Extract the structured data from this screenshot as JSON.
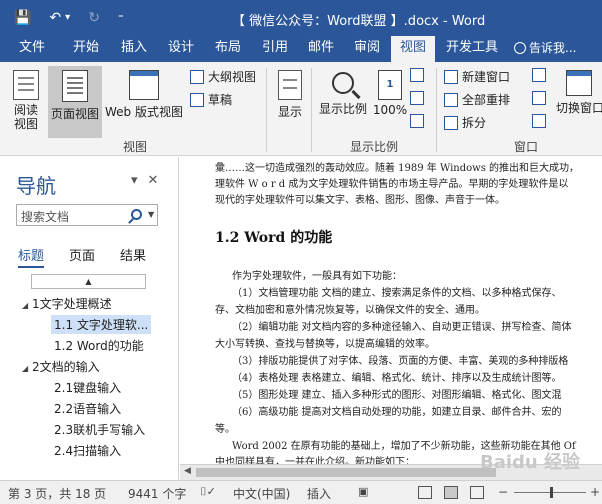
{
  "window": {
    "title": "【 微信公众号：Word联盟 】.docx - Word"
  },
  "qat": {
    "save_icon": "💾",
    "undo_icon": "↶",
    "undo_dropdown": "▾",
    "redo_icon": "↻",
    "customize_icon": "⁼"
  },
  "tabs": [
    "文件",
    "开始",
    "插入",
    "设计",
    "布局",
    "引用",
    "邮件",
    "审阅",
    "视图",
    "开发工具"
  ],
  "active_tab": "视图",
  "tell_me": "告诉我...",
  "ribbon": {
    "views": {
      "read_mode": "阅读视图",
      "print_layout": "页面视图",
      "web_layout": "Web 版式视图",
      "outline": "大纲视图",
      "draft": "草稿",
      "group_label": "视图"
    },
    "show": {
      "label": "显示"
    },
    "zoom": {
      "zoom": "显示比例",
      "hundred": "100%",
      "group_label": "显示比例"
    },
    "window": {
      "new_window": "新建窗口",
      "arrange_all": "全部重排",
      "split": "拆分",
      "switch_windows": "切换窗口",
      "group_label": "窗口"
    }
  },
  "nav": {
    "title": "导航",
    "search_placeholder": "搜索文档",
    "tabs": [
      "标题",
      "页面",
      "结果"
    ],
    "active_tab": "标题",
    "headings": [
      "1文字处理概述",
      "1.1 文字处理软...",
      "1.2 Word的功能",
      "2文档的输入",
      "2.1键盘输入",
      "2.2语音输入",
      "2.3联机手写输入",
      "2.4扫描输入"
    ]
  },
  "document": {
    "lines": [
      "彙……这一切造成强烈的轰动效应。随着 1989 年 Windows 的推出和巨大成功，",
      "理软件 W o r d 成为文字处理软件销售的市场主导产品。早期的字处理软件是以",
      "现代的字处理软件可以集文字、表格、图形、图像、声音于一体。"
    ],
    "heading": "1.2 Word 的功能",
    "body": [
      "作为字处理软件，一般具有如下功能：",
      "（1）文档管理功能   文档的建立、搜索满足条件的文档、以多种格式保存、",
      "存、文档加密和意外情况恢复等，以确保文件的安全、通用。",
      "（2）编辑功能  对文档内容的多种途径输入、自动更正错误、拼写检查、简体",
      "大小写转换、查找与替换等，以提高编辑的效率。",
      "（3）排版功能提供了对字体、段落、页面的方便、丰富、美观的多种排版格",
      "（4）表格处理   表格建立、编辑、格式化、统计、排序以及生成统计图等。",
      "（5）图形处理  建立、插入多种形式的图形、对图形编辑、格式化、图文混",
      "（6）高级功能  提高对文档自动处理的功能，如建立目录、邮件合并、宏的",
      "等。",
      "Word 2002 在原有功能的基础上，增加了不少新功能，这些新功能在其他 Of",
      "中也同样具有，一并在此介绍。新功能如下："
    ]
  },
  "watermark": "Baidu 经验",
  "status": {
    "page": "第 3 页，共 18 页",
    "words": "9441 个字",
    "language": "中文(中国)",
    "mode": "插入"
  },
  "colors": {
    "brand": "#2b579a",
    "ribbon_bg": "#f3f3f3",
    "selection": "#cde0f7"
  }
}
